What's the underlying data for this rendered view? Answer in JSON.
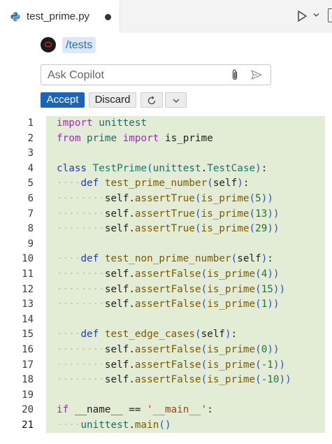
{
  "tab": {
    "title": "test_prime.py"
  },
  "chat": {
    "command": "/tests",
    "input_placeholder": "Ask Copilot",
    "accept_label": "Accept",
    "discard_label": "Discard"
  },
  "editor": {
    "line_numbers": [
      "1",
      "2",
      "3",
      "4",
      "5",
      "6",
      "7",
      "8",
      "9",
      "10",
      "11",
      "12",
      "13",
      "14",
      "15",
      "16",
      "17",
      "18",
      "19",
      "20",
      "21"
    ],
    "current_line": "21",
    "lines": [
      "import unittest",
      "from prime import is_prime",
      "",
      "class TestPrime(unittest.TestCase):",
      "    def test_prime_number(self):",
      "        self.assertTrue(is_prime(5))",
      "        self.assertTrue(is_prime(13))",
      "        self.assertTrue(is_prime(29))",
      "",
      "    def test_non_prime_number(self):",
      "        self.assertFalse(is_prime(4))",
      "        self.assertFalse(is_prime(15))",
      "        self.assertFalse(is_prime(1))",
      "",
      "    def test_edge_cases(self):",
      "        self.assertFalse(is_prime(0))",
      "        self.assertFalse(is_prime(-1))",
      "        self.assertFalse(is_prime(-10))",
      "",
      "if __name__ == '__main__':",
      "    unittest.main()"
    ]
  },
  "colors": {
    "accept_button": "#1d63b8",
    "diff_added_background": "#e3ecd4",
    "command_chip_text": "#2a6bbf"
  },
  "icons": [
    "python-file-icon",
    "unsaved-dot-icon",
    "run-icon",
    "chevron-down-icon",
    "split-editor-icon",
    "copilot-avatar-icon",
    "attach-icon",
    "send-icon",
    "refresh-icon"
  ]
}
